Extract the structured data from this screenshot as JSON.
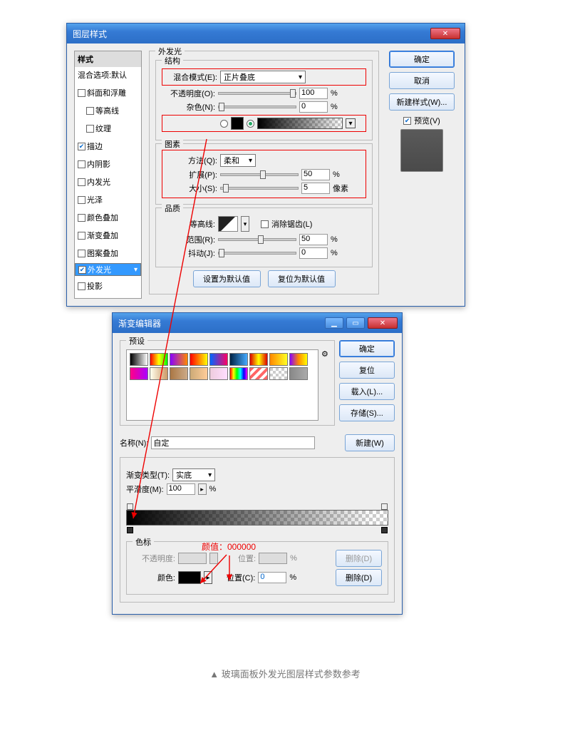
{
  "dialog1": {
    "title": "图层样式",
    "sidebar_hdr": "样式",
    "blend_default": "混合选项:默认",
    "styles": {
      "bevel": "斜面和浮雕",
      "contour": "等高线",
      "texture": "纹理",
      "stroke": "描边",
      "innershadow": "内阴影",
      "innerglow": "内发光",
      "satin": "光泽",
      "coloroverlay": "颜色叠加",
      "gradoverlay": "渐变叠加",
      "patternoverlay": "图案叠加",
      "outerglow": "外发光",
      "dropshadow": "投影"
    },
    "section_title": "外发光",
    "struct_title": "结构",
    "blendmode_label": "混合模式(E):",
    "blendmode_value": "正片叠底",
    "opacity_label": "不透明度(O):",
    "opacity_value": "100",
    "noise_label": "杂色(N):",
    "noise_value": "0",
    "pct": "%",
    "elem_title": "图素",
    "method_label": "方法(Q):",
    "method_value": "柔和",
    "spread_label": "扩展(P):",
    "spread_value": "50",
    "size_label": "大小(S):",
    "size_value": "5",
    "px": "像素",
    "quality_title": "品质",
    "contour_label": "等高线:",
    "antialias": "消除锯齿(L)",
    "range_label": "范围(R):",
    "range_value": "50",
    "jitter_label": "抖动(J):",
    "jitter_value": "0",
    "make_default": "设置为默认值",
    "reset_default": "复位为默认值",
    "ok": "确定",
    "cancel": "取消",
    "new_style": "新建样式(W)...",
    "preview": "预览(V)"
  },
  "dialog2": {
    "title": "渐变编辑器",
    "presets_label": "预设",
    "ok": "确定",
    "reset": "复位",
    "load": "载入(L)...",
    "save": "存储(S)...",
    "name_label": "名称(N):",
    "name_value": "自定",
    "new_btn": "新建(W)",
    "gradtype_label": "渐变类型(T):",
    "gradtype_value": "实底",
    "smooth_label": "平滑度(M):",
    "smooth_value": "100",
    "pct": "%",
    "stops_title": "色标",
    "opacity_label": "不透明度:",
    "pos_label": "位置:",
    "color_label": "颜色:",
    "posC_label": "位置(C):",
    "posC_value": "0",
    "delete": "删除(D)",
    "preset_colors": [
      "linear-gradient(90deg,#000,#fff)",
      "linear-gradient(90deg,#f00,#ff0,#0f0)",
      "linear-gradient(90deg,#80f,#f80)",
      "linear-gradient(90deg,#f00,#ff0)",
      "linear-gradient(90deg,#06f,#f06)",
      "linear-gradient(90deg,#024,#4af)",
      "linear-gradient(90deg,#d00,#ff0,#d00)",
      "linear-gradient(90deg,#f80,#ff2)",
      "linear-gradient(90deg,#80f,#f80,#ff0)",
      "linear-gradient(90deg,#f08,#a0f)",
      "linear-gradient(90deg,#ffe,#c96)",
      "linear-gradient(90deg,#a74,#ca8)",
      "linear-gradient(90deg,#ca7,#fc9)",
      "linear-gradient(90deg,#ecd,#fdf)",
      "linear-gradient(90deg,#f00,#ff0,#0f0,#0ff,#00f,#f0f)",
      "repeating-linear-gradient(135deg,#f66 0 4px,#fff 4px 8px)",
      "repeating-conic-gradient(#ccc 0 25%,#fff 0 50%) 0/8px 8px",
      "linear-gradient(90deg,#888,#aaa)"
    ]
  },
  "annotation": "颜值：000000",
  "caption": "▲    玻璃面板外发光图层样式参数参考"
}
